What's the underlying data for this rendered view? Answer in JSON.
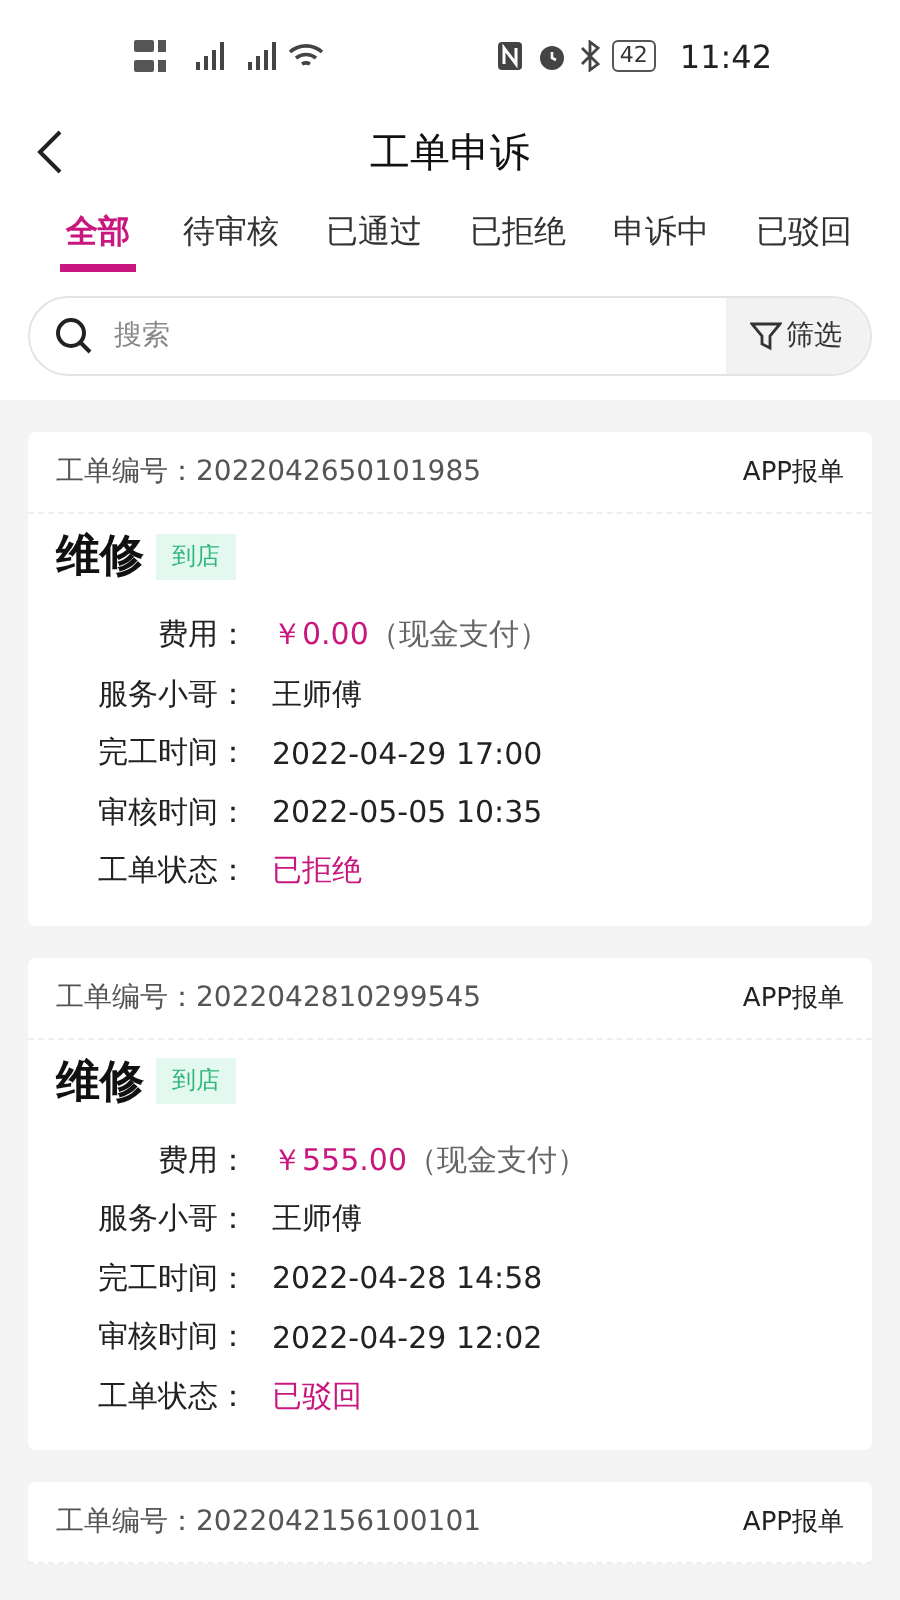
{
  "status_bar": {
    "time": "11:42",
    "battery": "42"
  },
  "header": {
    "title": "工单申诉"
  },
  "tabs": [
    {
      "label": "全部",
      "selected": true
    },
    {
      "label": "待审核",
      "selected": false
    },
    {
      "label": "已通过",
      "selected": false
    },
    {
      "label": "已拒绝",
      "selected": false
    },
    {
      "label": "申诉中",
      "selected": false
    },
    {
      "label": "已驳回",
      "selected": false
    }
  ],
  "search": {
    "placeholder": "搜索",
    "filter": "筛选"
  },
  "orders": [
    {
      "number_label": "工单编号：",
      "number": "2022042650101985",
      "source": "APP报单",
      "title": "维修",
      "tag": "到店",
      "rows": [
        {
          "label": "费用：",
          "kind": "fee",
          "value": "￥0.00",
          "note": "（现金支付）"
        },
        {
          "label": "服务小哥：",
          "kind": "text",
          "value": "王师傅"
        },
        {
          "label": "完工时间：",
          "kind": "text",
          "value": "2022-04-29 17:00"
        },
        {
          "label": "审核时间：",
          "kind": "text",
          "value": "2022-05-05 10:35"
        },
        {
          "label": "工单状态：",
          "kind": "status",
          "value": "已拒绝"
        }
      ]
    },
    {
      "number_label": "工单编号：",
      "number": "2022042810299545",
      "source": "APP报单",
      "title": "维修",
      "tag": "到店",
      "rows": [
        {
          "label": "费用：",
          "kind": "fee",
          "value": "￥555.00",
          "note": "（现金支付）"
        },
        {
          "label": "服务小哥：",
          "kind": "text",
          "value": "王师傅"
        },
        {
          "label": "完工时间：",
          "kind": "text",
          "value": "2022-04-28 14:58"
        },
        {
          "label": "审核时间：",
          "kind": "text",
          "value": "2022-04-29 12:02"
        },
        {
          "label": "工单状态：",
          "kind": "status",
          "value": "已驳回"
        }
      ]
    },
    {
      "number_label": "工单编号：",
      "number": "2022042156100101",
      "source": "APP报单"
    }
  ]
}
